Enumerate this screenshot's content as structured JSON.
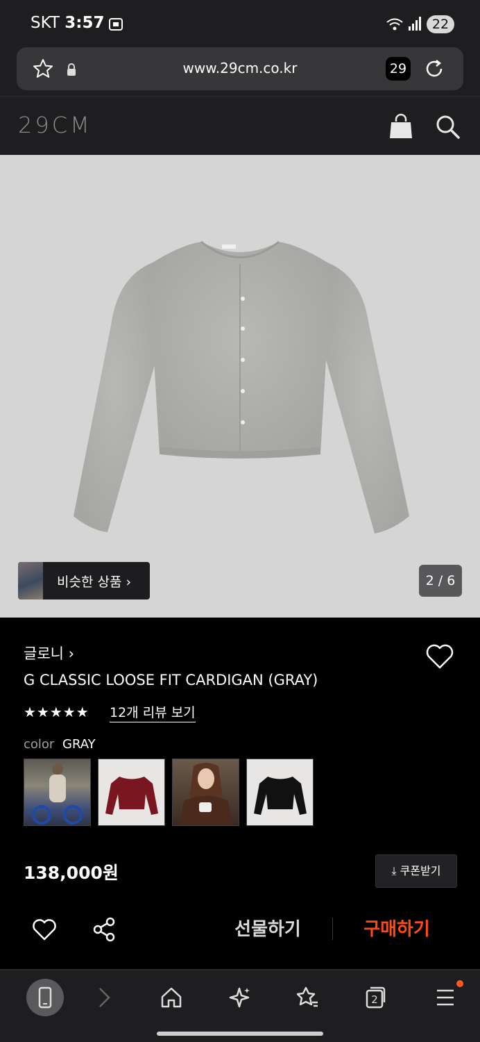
{
  "status_bar": {
    "carrier": "SKT",
    "time": "3:57",
    "battery": "22"
  },
  "browser": {
    "url": "www.29cm.co.kr",
    "tab_count": "29"
  },
  "site": {
    "logo": "29CM"
  },
  "gallery": {
    "similar_label": "비슷한 상품 ›",
    "pager": "2 / 6"
  },
  "product": {
    "brand": "글로니 ›",
    "title": "G CLASSIC LOOSE FIT CARDIGAN (GRAY)",
    "rating_stars": "★★★★★",
    "review_link": "12개 리뷰 보기",
    "color_label": "color",
    "color_value": "GRAY",
    "swatches": [
      "model-photo-1",
      "burgundy-cardigan",
      "model-photo-2",
      "black-cardigan"
    ],
    "price": "138,000원",
    "coupon_label": "⤓ 쿠폰받기"
  },
  "actions": {
    "gift_label": "선물하기",
    "buy_label": "구매하기",
    "buy_color": "#ff4a15"
  },
  "bottom_nav": {
    "tabs_count": "2"
  }
}
